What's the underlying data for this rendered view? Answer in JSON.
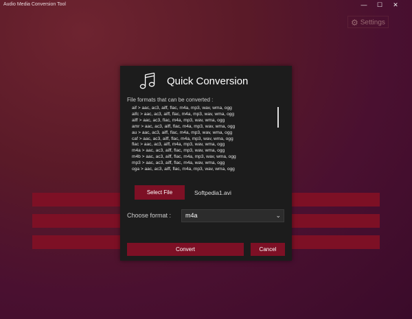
{
  "window": {
    "title": "Audio Media Conversion Tool",
    "minimize_glyph": "—",
    "maximize_glyph": "☐",
    "close_glyph": "✕"
  },
  "settings": {
    "label": "Settings",
    "icon": "gear-icon"
  },
  "dialog": {
    "title": "Quick Conversion",
    "icon": "music-note-icon",
    "formats_label": "File formats that can be converted :",
    "formats": [
      "aif > aac, ac3, aiff, flac, m4a, mp3, wav, wma, ogg",
      "aifc > aac, ac3, aiff, flac, m4a, mp3, wav, wma, ogg",
      "aiff > aac, ac3, flac, m4a, mp3, wav, wma, ogg",
      "amr > aac, ac3, aiff, flac, m4a, mp3, wav, wma, ogg",
      "au > aac, ac3, aiff, flac, m4a, mp3, wav, wma, ogg",
      "caf > aac, ac3, aiff, flac, m4a, mp3, wav, wma, ogg",
      "flac > aac, ac3, aiff, m4a, mp3, wav, wma, ogg",
      "m4a > aac, ac3, aiff, flac, mp3, wav, wma, ogg",
      "m4b > aac, ac3, aiff, flac, m4a, mp3, wav, wma, ogg",
      "mp3 > aac, ac3, aiff, flac, m4a, wav, wma, ogg",
      "oga > aac, ac3, aiff, flac, m4a, mp3, wav, wma, ogg"
    ],
    "select_file_label": "Select File",
    "selected_file": "Softpedia1.avi",
    "format_label": "Choose format :",
    "format_value": "m4a",
    "convert_label": "Convert",
    "cancel_label": "Cancel"
  },
  "colors": {
    "accent": "#7d1025",
    "dialog_bg": "#1c1c1c"
  }
}
